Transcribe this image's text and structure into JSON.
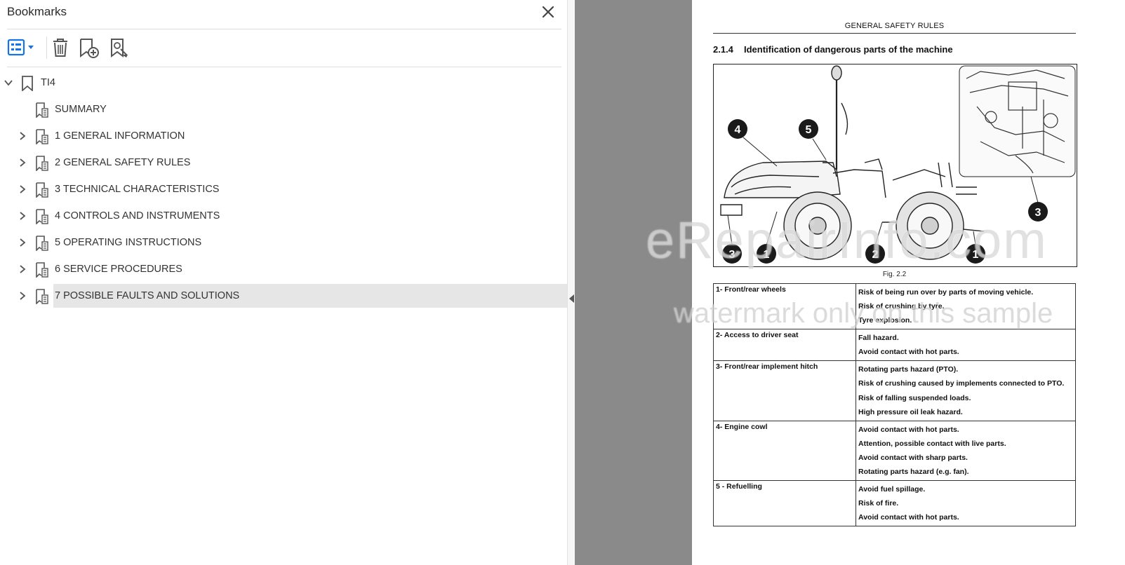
{
  "sidebar": {
    "title": "Bookmarks",
    "toolbar": {
      "options_icon": "bookmark-list-options-icon",
      "delete_icon": "trash-icon",
      "new_icon": "new-bookmark-icon",
      "find_icon": "find-bookmark-icon"
    },
    "root": {
      "label": "TI4",
      "expanded": true
    },
    "items": [
      {
        "label": "SUMMARY",
        "expandable": false
      },
      {
        "label": "1 GENERAL INFORMATION",
        "expandable": true
      },
      {
        "label": "2 GENERAL SAFETY RULES",
        "expandable": true
      },
      {
        "label": "3 TECHNICAL CHARACTERISTICS",
        "expandable": true
      },
      {
        "label": "4 CONTROLS AND INSTRUMENTS",
        "expandable": true
      },
      {
        "label": "5 OPERATING INSTRUCTIONS",
        "expandable": true
      },
      {
        "label": "6 SERVICE PROCEDURES",
        "expandable": true
      },
      {
        "label": "7 POSSIBLE FAULTS AND SOLUTIONS",
        "expandable": true,
        "selected": true
      }
    ]
  },
  "document": {
    "header": "GENERAL SAFETY RULES",
    "section_number": "2.1.4",
    "section_title": "Identification of dangerous parts of the machine",
    "figure_caption": "Fig. 2.2",
    "callouts": [
      "4",
      "5",
      "3",
      "1",
      "2",
      "1",
      "3"
    ],
    "table": [
      {
        "part": "1- Front/rear wheels",
        "risks": [
          "Risk of being run over by parts of moving vehicle.",
          "Risk of crushing by tyre.",
          "Tyre explosion."
        ]
      },
      {
        "part": "2- Access to driver seat",
        "risks": [
          "Fall hazard.",
          "Avoid contact with hot parts."
        ]
      },
      {
        "part": "3- Front/rear implement hitch",
        "risks": [
          "Rotating parts hazard (PTO).",
          "Risk of crushing caused by implements connected to PTO.",
          "Risk of falling suspended loads.",
          "High pressure oil leak hazard."
        ]
      },
      {
        "part": "4- Engine cowl",
        "risks": [
          "Avoid contact with hot parts.",
          "Attention, possible contact with live parts.",
          "Avoid contact with sharp parts.",
          "Rotating parts hazard (e.g. fan)."
        ]
      },
      {
        "part": "5 - Refuelling",
        "risks": [
          "Avoid fuel spillage.",
          "Risk of fire.",
          "Avoid contact with hot parts."
        ]
      }
    ]
  },
  "watermark": {
    "line1": "eRepairInfo.com",
    "line2": "watermark only on this sample"
  },
  "colors": {
    "selected_row": "#e6e6e6",
    "accent": "#1473e6",
    "viewer_bg": "#8a8a8a"
  }
}
